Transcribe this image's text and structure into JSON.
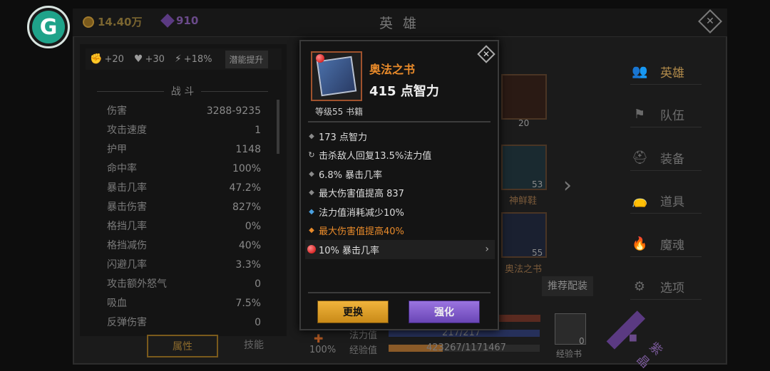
{
  "header": {
    "gold": "14.40万",
    "gems": "910",
    "title": "英 雄"
  },
  "bonus": {
    "attack": "+20",
    "health": "+30",
    "power": "+18%",
    "button_label": "潜能提升"
  },
  "stats": {
    "section_title": "战 斗",
    "rows": [
      {
        "label": "伤害",
        "value": "3288-9235"
      },
      {
        "label": "攻击速度",
        "value": "1"
      },
      {
        "label": "护甲",
        "value": "1148"
      },
      {
        "label": "命中率",
        "value": "100%"
      },
      {
        "label": "暴击几率",
        "value": "47.2%"
      },
      {
        "label": "暴击伤害",
        "value": "827%"
      },
      {
        "label": "格挡几率",
        "value": "0%"
      },
      {
        "label": "格挡减伤",
        "value": "40%"
      },
      {
        "label": "闪避几率",
        "value": "3.3%"
      },
      {
        "label": "攻击额外怒气",
        "value": "0"
      },
      {
        "label": "吸血",
        "value": "7.5%"
      },
      {
        "label": "反弹伤害",
        "value": "0"
      }
    ]
  },
  "tabs": [
    "属性",
    "技能"
  ],
  "background": {
    "slot1_count": "20",
    "boots_label": "神鲜鞋",
    "boots_count": "53",
    "book_label": "奥法之书",
    "book_count": "55",
    "recommend_button": "推荐配装",
    "mana_label": "法力值",
    "mana_value": "217/217",
    "exp_label": "经验值",
    "exp_value": "423267/1171467",
    "exp_book_label": "经验书",
    "exp_book_count": "0",
    "potion_pct": "100%"
  },
  "right_menu": [
    {
      "label": "英雄",
      "icon": "heroes-icon"
    },
    {
      "label": "队伍",
      "icon": "flag-icon"
    },
    {
      "label": "装备",
      "icon": "helmet-icon"
    },
    {
      "label": "道具",
      "icon": "bag-icon"
    },
    {
      "label": "魔魂",
      "icon": "flame-icon"
    },
    {
      "label": "选项",
      "icon": "gear-icon"
    },
    {
      "label": "紫晶",
      "icon": "amethyst-icon"
    }
  ],
  "item": {
    "name": "奥法之书",
    "main_stat": "415 点智力",
    "level_type": "等级55 书籍",
    "attributes": [
      {
        "text": "173 点智力",
        "style": "normal"
      },
      {
        "text": "击杀敌人回复13.5%法力值",
        "style": "cycle"
      },
      {
        "text": "6.8% 暴击几率",
        "style": "normal"
      },
      {
        "text": "最大伤害值提高 837",
        "style": "normal"
      },
      {
        "text": "法力值消耗减少10%",
        "style": "cyan"
      },
      {
        "text": "最大伤害值提高40%",
        "style": "orange"
      },
      {
        "text": "10% 暴击几率",
        "style": "socket"
      }
    ],
    "replace_button": "更换",
    "enhance_button": "强化"
  },
  "colors": {
    "orange": "#e88a2a",
    "cyan": "#4aa0e0",
    "gold_button": "#e0a22c",
    "purple_button": "#8560d0"
  }
}
